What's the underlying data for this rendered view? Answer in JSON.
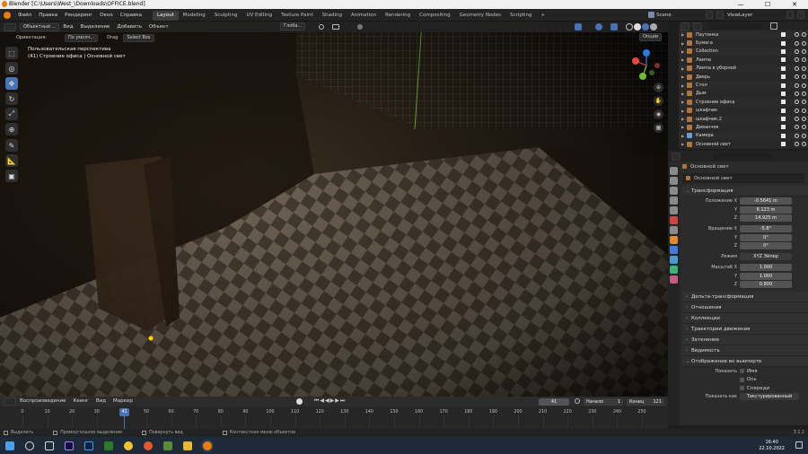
{
  "window": {
    "title": "Blender [C:\\Users\\West_\\Downloads\\OFFICE.blend]",
    "minimize": "—",
    "maximize": "☐",
    "close": "✕"
  },
  "menubar": {
    "items": [
      "Файл",
      "Правка",
      "Рендеринг",
      "Окно",
      "Справка"
    ],
    "workspaces": [
      "Layout",
      "Modeling",
      "Sculpting",
      "UV Editing",
      "Texture Paint",
      "Shading",
      "Animation",
      "Rendering",
      "Compositing",
      "Geometry Nodes",
      "Scripting"
    ],
    "active_workspace": "Layout",
    "add_tab": "+",
    "scene": "Scene",
    "view_layer": "ViewLayer"
  },
  "viewport": {
    "mode": "Объектный ...",
    "menu": [
      "Вид",
      "Выделение",
      "Добавить",
      "Объект"
    ],
    "orientation_label": "Ориентация:",
    "orientation_value": "По умолч...",
    "drag_label": "Drag",
    "select_box": "Select Box",
    "transform_global": "Глоба...",
    "options": "Опции",
    "perspective_text": "Пользовательская перспектива",
    "object_text": "(41) Строение офиса | Основной свет"
  },
  "toolbar": {
    "tools": [
      "select-box-icon",
      "cursor-icon",
      "move-icon",
      "rotate-icon",
      "scale-icon",
      "transform-icon",
      "annotate-icon",
      "measure-icon",
      "add-cube-icon"
    ],
    "active_index": 2
  },
  "outliner": {
    "search_placeholder": "",
    "items": [
      {
        "name": "Паутинка",
        "icon_color": "#b3733c"
      },
      {
        "name": "Бумага",
        "icon_color": "#b3733c"
      },
      {
        "name": "Collection",
        "icon_color": "#b3733c"
      },
      {
        "name": "Лампа",
        "icon_color": "#b3733c"
      },
      {
        "name": "Лампа в уборной",
        "icon_color": "#b3733c"
      },
      {
        "name": "Дверь",
        "icon_color": "#b3733c"
      },
      {
        "name": "Стол",
        "icon_color": "#b3733c"
      },
      {
        "name": "Дым",
        "icon_color": "#b3733c"
      },
      {
        "name": "Строение офиса",
        "icon_color": "#b3733c"
      },
      {
        "name": "шкафчик",
        "icon_color": "#b3733c"
      },
      {
        "name": "шкафчик.2",
        "icon_color": "#b3733c"
      },
      {
        "name": "Диванчик",
        "icon_color": "#b3733c"
      },
      {
        "name": "Камера",
        "icon_color": "#6a9bd1"
      },
      {
        "name": "Основной свет",
        "icon_color": "#b3733c"
      }
    ]
  },
  "properties": {
    "object_name": "Основной свет",
    "object_field": "Основной свет",
    "transform_title": "Трансформация",
    "location": {
      "label": "Положение X",
      "x": "-0.5641 m",
      "y": "8.123 m",
      "z": "14.925 m"
    },
    "rotation": {
      "label": "Вращение X",
      "x": "-5.8°",
      "y": "0°",
      "z": "0°"
    },
    "mode_label": "Режим",
    "mode_value": "XYZ Эйлер",
    "scale": {
      "label": "Масштаб X",
      "x": "1.000",
      "y": "1.000",
      "z": "0.800"
    },
    "axis_y": "Y",
    "axis_z": "Z",
    "delta_transform": "Дельта-трансформация",
    "sections": [
      "Отношения",
      "Коллекции",
      "Траектории движения",
      "Затенение",
      "Видимость"
    ],
    "viewport_display": "Отображение во вьюпорте",
    "show_label": "Показать",
    "show_options": [
      "Имя",
      "Ось",
      "Спереди"
    ],
    "display_as_label": "Показать как",
    "display_as_value": "Текстурированный"
  },
  "timeline": {
    "playback": "Воспроизведение",
    "keying": "Кеинг",
    "view": "Вид",
    "marker": "Маркер",
    "current_frame": "41",
    "start_label": "Начало",
    "start_value": "1",
    "end_label": "Конец",
    "end_value": "121",
    "ticks": [
      "0",
      "10",
      "20",
      "30",
      "41",
      "50",
      "60",
      "70",
      "80",
      "90",
      "100",
      "110",
      "120",
      "130",
      "140",
      "150",
      "160",
      "170",
      "180",
      "190",
      "200",
      "210",
      "220",
      "230",
      "240",
      "250"
    ]
  },
  "statusbar": {
    "items": [
      "Выделить",
      "Прямоугольное выделение",
      "Повернуть вид",
      "Контекстное меню объектов"
    ],
    "version": "3.1.2"
  },
  "taskbar": {
    "time": "16:40",
    "date": "22.10.2022",
    "apps": [
      "windows-icon",
      "search-icon",
      "taskview-icon",
      "after-effects-icon",
      "photoshop-icon",
      "xbox-icon",
      "yandex-icon",
      "browser-icon",
      "minecraft-icon",
      "files-icon",
      "blender-icon"
    ]
  },
  "colors": {
    "accent": "#4772b3",
    "orange": "#e28a2b"
  }
}
